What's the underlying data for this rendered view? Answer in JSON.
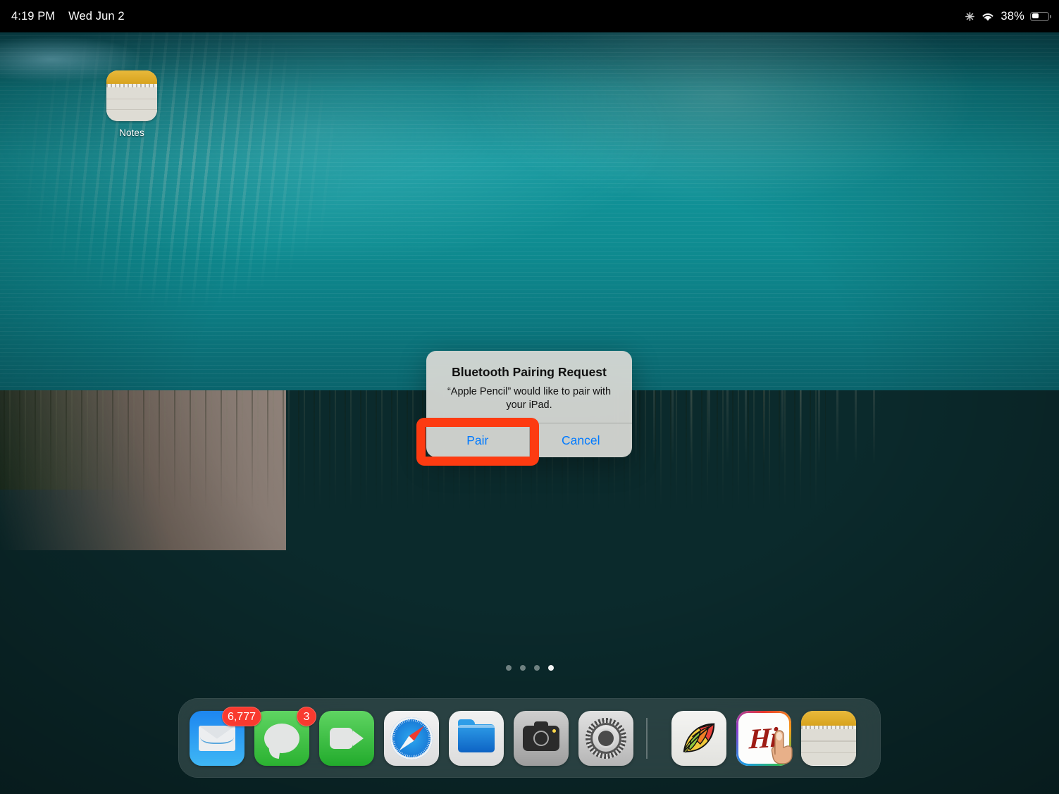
{
  "status_bar": {
    "time": "4:19 PM",
    "date": "Wed Jun 2",
    "battery_percent": "38%",
    "icons": [
      "sparkle-icon",
      "wifi-icon",
      "battery-icon"
    ]
  },
  "home_screen": {
    "apps": [
      {
        "label": "Notes",
        "icon": "notes-icon"
      }
    ],
    "page_dots": {
      "count": 4,
      "active_index": 3
    }
  },
  "dialog": {
    "title": "Bluetooth Pairing Request",
    "message": "“Apple Pencil” would like to pair with your iPad.",
    "buttons": [
      {
        "label": "Pair",
        "highlighted": true
      },
      {
        "label": "Cancel",
        "highlighted": false
      }
    ],
    "accent_color": "#007aff",
    "highlight_color": "#fd3b11"
  },
  "dock": {
    "apps": [
      {
        "label": "Mail",
        "icon": "mail-icon",
        "badge": "6,777"
      },
      {
        "label": "Messages",
        "icon": "messages-icon",
        "badge": "3"
      },
      {
        "label": "FaceTime",
        "icon": "facetime-icon",
        "badge": ""
      },
      {
        "label": "Safari",
        "icon": "safari-icon",
        "badge": ""
      },
      {
        "label": "Files",
        "icon": "files-icon",
        "badge": ""
      },
      {
        "label": "Camera",
        "icon": "camera-icon",
        "badge": ""
      },
      {
        "label": "Settings",
        "icon": "settings-icon",
        "badge": ""
      }
    ],
    "recents": [
      {
        "label": "Sketches",
        "icon": "leaf-icon",
        "badge": ""
      },
      {
        "label": "Hi",
        "icon": "handwriting-icon",
        "badge": ""
      },
      {
        "label": "Notes",
        "icon": "notes-icon",
        "badge": ""
      }
    ],
    "badge_color": "#f93a2f"
  },
  "cursor": {
    "type": "pointing-finger",
    "over": "Hi"
  }
}
